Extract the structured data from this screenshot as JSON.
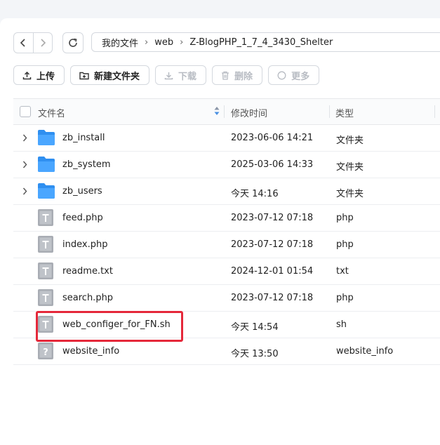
{
  "breadcrumb": [
    "我的文件",
    "web",
    "Z-BlogPHP_1_7_4_3430_Shelter"
  ],
  "toolbar": {
    "upload": "上传",
    "new_folder": "新建文件夹",
    "download": "下载",
    "delete": "删除",
    "more": "更多"
  },
  "table": {
    "headers": {
      "name": "文件名",
      "modified": "修改时间",
      "type": "类型"
    },
    "rows": [
      {
        "name": "zb_install",
        "modified": "2023-06-06 14:21",
        "type": "文件夹",
        "kind": "folder"
      },
      {
        "name": "zb_system",
        "modified": "2025-03-06 14:33",
        "type": "文件夹",
        "kind": "folder"
      },
      {
        "name": "zb_users",
        "modified": "今天 14:16",
        "type": "文件夹",
        "kind": "folder"
      },
      {
        "name": "feed.php",
        "modified": "2023-07-12 07:18",
        "type": "php",
        "kind": "text-file"
      },
      {
        "name": "index.php",
        "modified": "2023-07-12 07:18",
        "type": "php",
        "kind": "text-file"
      },
      {
        "name": "readme.txt",
        "modified": "2024-12-01 01:54",
        "type": "txt",
        "kind": "text-file"
      },
      {
        "name": "search.php",
        "modified": "2023-07-12 07:18",
        "type": "php",
        "kind": "text-file"
      },
      {
        "name": "web_configer_for_FN.sh",
        "modified": "今天 14:54",
        "type": "sh",
        "kind": "text-file",
        "highlighted": true
      },
      {
        "name": "website_info",
        "modified": "今天 13:50",
        "type": "website_info",
        "kind": "unknown-file"
      }
    ]
  },
  "colors": {
    "folder": "#2f8ff0",
    "file": "#a9adb4",
    "highlight": "#e5283a"
  }
}
